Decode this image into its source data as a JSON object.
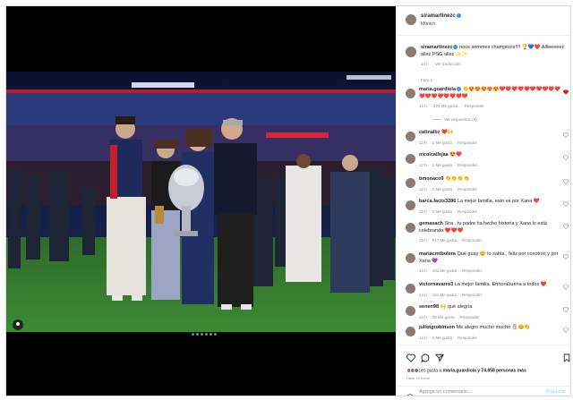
{
  "post": {
    "author": "siramartinezc",
    "location": "Múnich",
    "caption_user": "siramartinezc",
    "caption_text": "nous sommes champions!!!! 🏆💙❤️ Allleeeeez allez PSG allez ✨✨",
    "caption_time": "15 h",
    "caption_translate": "Ver traducción",
    "pinned_label": "Para ti",
    "view_replies": "Ver respuestas (5)",
    "comments": [
      {
        "user": "maria.guardiola",
        "text": "👏😍😍😍😍😍❤️❤️❤️❤️❤️❤️❤️❤️❤️❤️❤️❤️❤️❤️❤️❤️❤️❤️",
        "time": "12 h",
        "likes": "325 Me gusta",
        "reply": "Responder"
      },
      {
        "user": "catinalbz",
        "text": "❤️🙌",
        "time": "12 h",
        "likes": "2 Me gusta",
        "reply": "Responder"
      },
      {
        "user": "nicolcallejaa",
        "text": "😍❤️",
        "time": "12 h",
        "likes": "1 Me gusta",
        "reply": "Responder"
      },
      {
        "user": "bmonaco9",
        "text": "👏👏👏👏",
        "time": "12 h",
        "likes": "2 Me gusta",
        "reply": "Responder"
      },
      {
        "user": "barca.facts3286",
        "text": "La mejor familia, esto va por Xana ❤️",
        "time": "12 h",
        "likes": "2 Me gusta",
        "reply": "Responder"
      },
      {
        "user": "gemasach",
        "text": "Sira , tu padre ha hecho historia y Xana lo está celebrando ❤️❤️❤️",
        "time": "15 h",
        "likes": "517 Me gusta",
        "reply": "Responder"
      },
      {
        "user": "mariacmtbolera",
        "text": "Qué guay 😊 lo sabía , feliz por vosotros y por Xana 💜",
        "time": "14 h",
        "likes": "191 Me gusta",
        "reply": "Responder"
      },
      {
        "user": "victornavarro3",
        "text": "La mejor familia. Enhorabuena a todos ❤️",
        "time": "14 h",
        "likes": "101 Me gusta",
        "reply": "Responder"
      },
      {
        "user": "senen98",
        "text": "🙌 qué alegría",
        "time": "14 h",
        "likes": "35 Me gusta",
        "reply": "Responder"
      },
      {
        "user": "juliotgrobinson",
        "text": "Me alegro mucho mucho ‼️😊👏",
        "time": "12 h",
        "likes": "2 Me gusta",
        "reply": "Responder"
      }
    ],
    "likes_prefix": "Les gusta a",
    "likes_user": "maria.guardiola",
    "likes_suffix": "y 74.858 personas más",
    "posted_ago": "Hace 15 horas",
    "add_comment_placeholder": "Agrega un comentario...",
    "publish_label": "Publicar"
  },
  "colors": {
    "verified": "#3897f0",
    "link_muted": "#8e8e8e",
    "publish_disabled": "#b2dffc"
  },
  "icons": [
    "heart-icon",
    "comment-icon",
    "share-icon",
    "bookmark-icon",
    "emoji-icon",
    "user-tag-icon",
    "verified-icon"
  ]
}
